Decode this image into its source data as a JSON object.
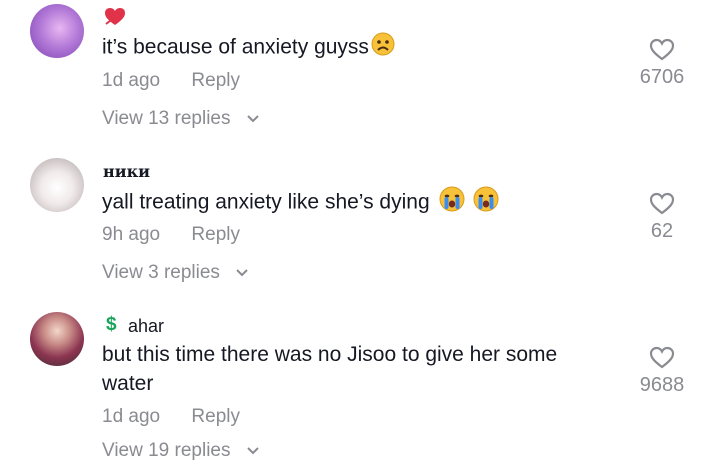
{
  "comments": [
    {
      "username": "",
      "badge_icon": "heart-arrow-icon",
      "text": "it’s because of anxiety guyss",
      "emoji_icons": [
        "frowning-face-icon"
      ],
      "age": "1d ago",
      "reply_label": "Reply",
      "likes": "6706",
      "view_replies": "View 13 replies"
    },
    {
      "username": "ники",
      "text": "yall treating anxiety like she’s dying",
      "emoji_icons": [
        "crying-face-icon",
        "crying-face-icon"
      ],
      "age": "9h ago",
      "reply_label": "Reply",
      "likes": "62",
      "view_replies": "View 3 replies"
    },
    {
      "username": "ahar",
      "badge_icon": "dollar-sign-icon",
      "text_line1": "but this time there was no Jisoo to give her some",
      "text_line2": "water",
      "age": "1d ago",
      "reply_label": "Reply",
      "likes": "9688",
      "view_replies": "View 19 replies"
    }
  ],
  "colors": {
    "text": "#161823",
    "secondary": "#8a8b91",
    "badge_red": "#e0334a",
    "dollar_green": "#1aa35a"
  }
}
